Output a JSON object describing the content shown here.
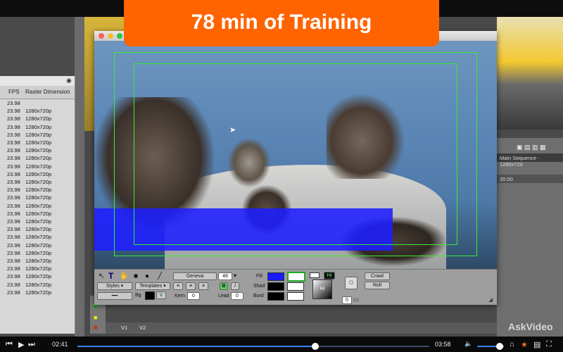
{
  "banner": {
    "text": "78 min of Training",
    "color": "#ff6400"
  },
  "bin": {
    "col_fps": "FPS",
    "col_raster": "Raster Dimension",
    "rows": [
      {
        "fps": "23.98",
        "raster": ""
      },
      {
        "fps": "23.98",
        "raster": "1280x720p"
      },
      {
        "fps": "23.98",
        "raster": "1280x720p"
      },
      {
        "fps": "23.98",
        "raster": "1280x720p"
      },
      {
        "fps": "23.98",
        "raster": "1280x720p"
      },
      {
        "fps": "23.98",
        "raster": "1280x720p"
      },
      {
        "fps": "23.98",
        "raster": "1280x720p"
      },
      {
        "fps": "23.98",
        "raster": "1280x720p"
      },
      {
        "fps": "23.98",
        "raster": "1280x720p"
      },
      {
        "fps": "23.98",
        "raster": "1280x720p"
      },
      {
        "fps": "23.98",
        "raster": "1280x720p"
      },
      {
        "fps": "23.98",
        "raster": "1280x720p"
      },
      {
        "fps": "23.98",
        "raster": "1280x720p"
      },
      {
        "fps": "23.98",
        "raster": "1280x720p"
      },
      {
        "fps": "23.98",
        "raster": "1280x720p"
      },
      {
        "fps": "23.98",
        "raster": "1280x720p"
      },
      {
        "fps": "23.98",
        "raster": "1280x720p"
      },
      {
        "fps": "23.98",
        "raster": "1280x720p"
      },
      {
        "fps": "23.98",
        "raster": "1280x720p"
      },
      {
        "fps": "23.98",
        "raster": "1280x720p"
      },
      {
        "fps": "23.98",
        "raster": "1280x720p"
      },
      {
        "fps": "23.98",
        "raster": "1280x720p"
      },
      {
        "fps": "23.98",
        "raster": "1280x720p"
      },
      {
        "fps": "23.98",
        "raster": "1280x720p"
      },
      {
        "fps": "23.98",
        "raster": "1280x720p"
      }
    ]
  },
  "sequence": {
    "name": "Main Sequence - 1280x720",
    "timecode": "20:00"
  },
  "timeline": {
    "track1": "V1",
    "track2": "V2"
  },
  "title_tool": {
    "font": "Geneva",
    "font_size": "48",
    "styles_label": "Styles",
    "templates_label": "Templates",
    "bold": "B",
    "italic": "I",
    "bg_label": "Bg",
    "kern_label": "Kern",
    "kern_value": "0",
    "lead_label": "Lead",
    "lead_value": "0",
    "fill_label": "Fill",
    "shad_label": "Shad",
    "bord_label": "Bord",
    "hi_label": "Hi",
    "hi_swatch_label": "Hi",
    "opacity_value": "0",
    "crawl_label": "Crawl",
    "roll_label": "Roll",
    "fill_color": "#1a1aff"
  },
  "player": {
    "elapsed": "02:41",
    "duration": "03:58",
    "progress": 0.676,
    "volume": 0.85,
    "watermark": "AskVideo"
  }
}
